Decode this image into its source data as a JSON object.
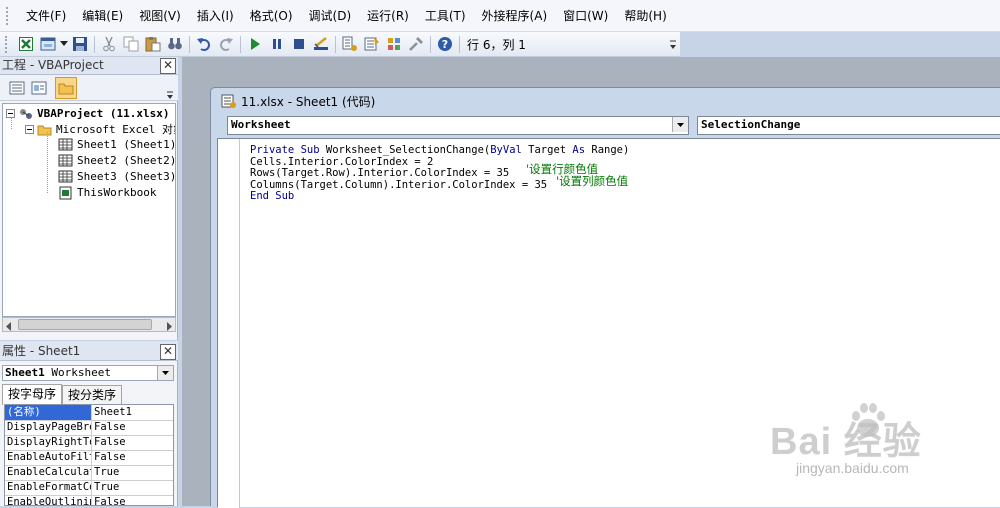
{
  "menu": [
    "文件(F)",
    "编辑(E)",
    "视图(V)",
    "插入(I)",
    "格式(O)",
    "调试(D)",
    "运行(R)",
    "工具(T)",
    "外接程序(A)",
    "窗口(W)",
    "帮助(H)"
  ],
  "toolbar": {
    "icons": [
      "excel-view-icon",
      "insert-userform-icon",
      "dropdown-arrow-icon",
      "save-icon",
      "cut-icon",
      "copy-icon",
      "paste-icon",
      "find-icon",
      "undo-icon",
      "redo-icon",
      "run-icon",
      "break-icon",
      "reset-icon",
      "design-mode-icon",
      "project-explorer-icon",
      "properties-window-icon",
      "object-browser-icon",
      "toolbox-icon",
      "help-icon"
    ],
    "status": "行 6，列 1"
  },
  "project": {
    "title": "工程 - VBAProject",
    "tree": {
      "root": "VBAProject (11.xlsx)",
      "folder": "Microsoft Excel 对象",
      "items": [
        "Sheet1 (Sheet1)",
        "Sheet2 (Sheet2)",
        "Sheet3 (Sheet3)",
        "ThisWorkbook"
      ]
    }
  },
  "properties": {
    "title": "属性 - Sheet1",
    "object_combo": {
      "name": "Sheet1",
      "type": "Worksheet"
    },
    "tabs": [
      "按字母序",
      "按分类序"
    ],
    "rows": [
      {
        "name": "(名称)",
        "value": "Sheet1"
      },
      {
        "name": "DisplayPageBreaks",
        "value": "False"
      },
      {
        "name": "DisplayRightToLeft",
        "value": "False"
      },
      {
        "name": "EnableAutoFilter",
        "value": "False"
      },
      {
        "name": "EnableCalculation",
        "value": "True"
      },
      {
        "name": "EnableFormatConditionsCalculation",
        "value": "True"
      },
      {
        "name": "EnableOutlining",
        "value": "False"
      }
    ]
  },
  "code_window": {
    "title": "11.xlsx - Sheet1 (代码)",
    "object_combo": "Worksheet",
    "proc_combo": "SelectionChange",
    "lines": [
      {
        "k1": "Private Sub",
        "t1": " Worksheet_SelectionChange(",
        "k2": "ByVal",
        "t2": " Target ",
        "k3": "As",
        "t3": " Range)"
      },
      {
        "t1": "Cells.Interior.ColorIndex = 2"
      },
      {
        "t1": "Rows(Target.Row).Interior.ColorIndex = 35",
        "comment": "'设置行颜色值"
      },
      {
        "t1": "Columns(Target.Column).Interior.ColorIndex = 35",
        "comment": "'设置列颜色值"
      },
      {
        "k1": "End Sub"
      }
    ]
  },
  "watermark": {
    "brand": "Bai 经验",
    "url": "jingyan.baidu.com"
  },
  "colors": {
    "keyword": "#00008b",
    "comment": "#007a00",
    "selection": "#3168d5",
    "workspace": "#aab2bd"
  }
}
